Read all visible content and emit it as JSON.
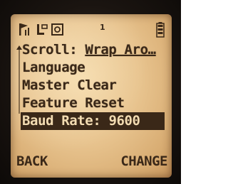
{
  "status_bar": {
    "icons": [
      "signal-flag-icon",
      "talk-mode-icon",
      "call-log-icon",
      "battery-icon"
    ],
    "mark": "1"
  },
  "menu": {
    "items": [
      {
        "label": "Scroll: ",
        "value": "Wrap Aro…",
        "selected": false
      },
      {
        "label": "Language",
        "value": "",
        "selected": false
      },
      {
        "label": "Master Clear",
        "value": "",
        "selected": false
      },
      {
        "label": "Feature Reset",
        "value": "",
        "selected": false
      },
      {
        "label": "Baud Rate: ",
        "value": "9600",
        "selected": true
      }
    ]
  },
  "softkeys": {
    "left": "BACK",
    "right": "CHANGE"
  },
  "colors": {
    "lcd_backlight": "#e8c48f",
    "lcd_text": "#3a2818",
    "bezel": "#1a1410"
  }
}
